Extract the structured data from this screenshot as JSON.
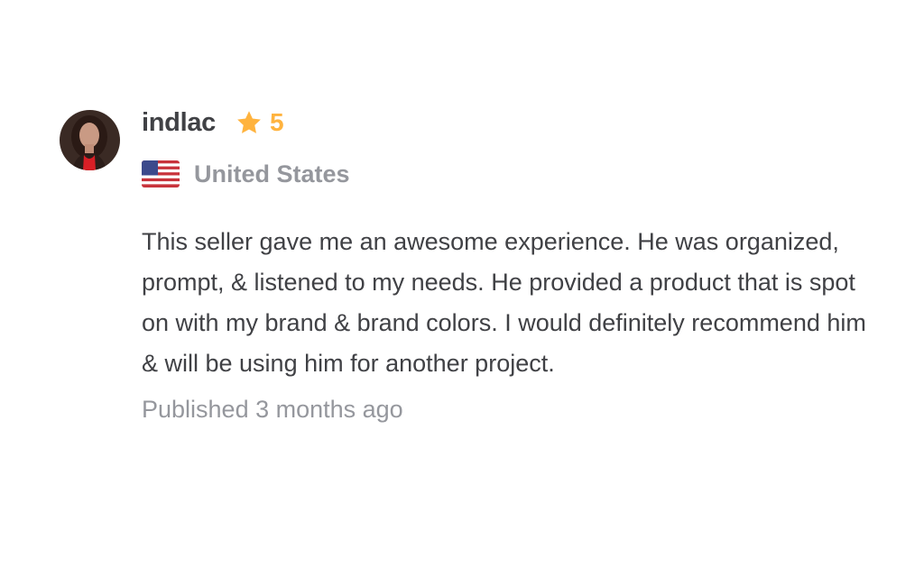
{
  "review": {
    "username": "indlac",
    "rating": "5",
    "country": "United States",
    "text": "This seller gave me an awesome experience. He was organized, prompt, & listened to my needs. He provided a product that is spot on with my brand & brand colors. I would definitely recommend him & will be using him for another project.",
    "published": "Published 3 months ago",
    "icons": {
      "avatar": "user-avatar",
      "rating": "star-icon",
      "country": "us-flag-icon"
    },
    "colors": {
      "star": "#ffb33e",
      "text": "#404145",
      "muted": "#95979d"
    }
  }
}
